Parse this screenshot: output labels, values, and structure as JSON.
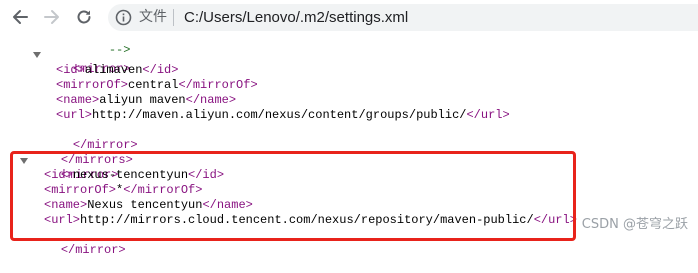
{
  "browser": {
    "scheme_label": "文件",
    "url": "C:/Users/Lenovo/.m2/settings.xml",
    "icons": {
      "back": "arrow-left-icon",
      "forward": "arrow-right-icon",
      "reload": "reload-icon",
      "info": "info-circle-icon"
    }
  },
  "xml": {
    "comment_close": "-->",
    "mirror1": {
      "open": "<mirror>",
      "id_open": "<id>",
      "id": "alimaven",
      "id_close": "</id>",
      "mirrorOf_open": "<mirrorOf>",
      "mirrorOf": "central",
      "mirrorOf_close": "</mirrorOf>",
      "name_open": "<name>",
      "name": "aliyun maven",
      "name_close": "</name>",
      "url_open": "<url>",
      "url": "http://maven.aliyun.com/nexus/content/groups/public/",
      "url_close": "</url>",
      "close": "</mirror>"
    },
    "mirrors_close": "</mirrors>",
    "mirror2": {
      "open": "<mirror>",
      "id_open": "<id>",
      "id": "nexus-tencentyun",
      "id_close": "</id>",
      "mirrorOf_open": "<mirrorOf>",
      "mirrorOf": "*",
      "mirrorOf_close": "</mirrorOf>",
      "name_open": "<name>",
      "name": "Nexus tencentyun",
      "name_close": "</name>",
      "url_open": "<url>",
      "url": "http://mirrors.cloud.tencent.com/nexus/repository/maven-public/",
      "url_close": "</url>",
      "close": "</mirror>"
    }
  },
  "watermark": "CSDN @苍穹之跃",
  "colors": {
    "tag": "#881280",
    "text": "#000000",
    "comment": "#236e25",
    "highlight": "#e8231b"
  }
}
